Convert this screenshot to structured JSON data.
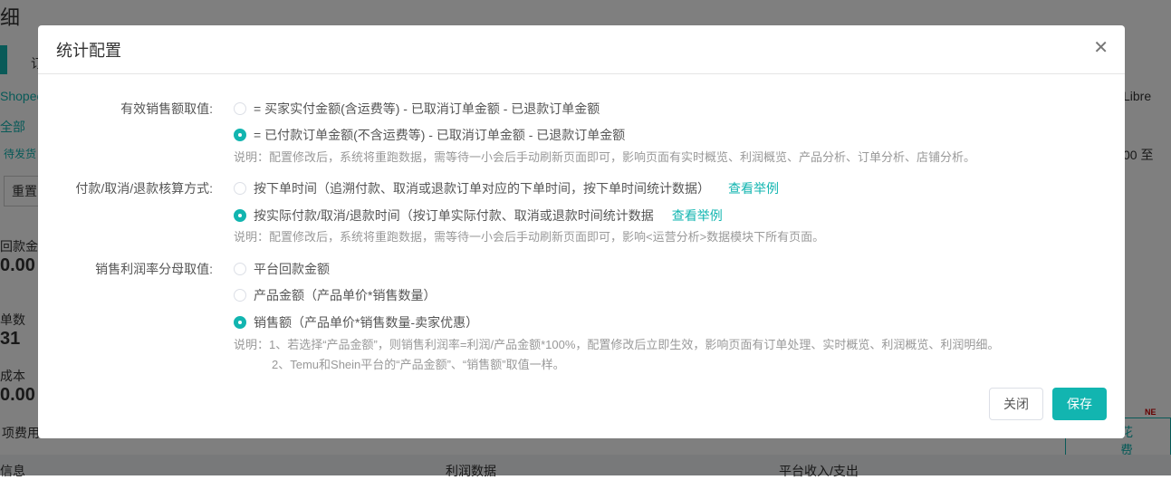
{
  "background": {
    "title": "细",
    "tab": "订",
    "shop1": "Shopee",
    "shop2": "Libre",
    "filter_all": "全部",
    "filter_pending": "待发货",
    "reset": "重置",
    "date_sep": "00 至",
    "stat1_label": "回款金额",
    "stat1_value": "0.00",
    "stat2_label": "单数",
    "stat2_value": "31",
    "stat3_label": "成本",
    "stat3_value": "0.00",
    "fee_label": "项费用",
    "fee_select": "花费",
    "new_badge": "NE",
    "section1": "信息",
    "section2": "利润数据",
    "section3": "平台收入/支出"
  },
  "dialog": {
    "title": "统计配置",
    "sections": [
      {
        "label": "有效销售额取值:",
        "options": [
          {
            "text": "= 买家实付金额(含运费等) - 已取消订单金额 - 已退款订单金额",
            "checked": false
          },
          {
            "text": "= 已付款订单金额(不含运费等) - 已取消订单金额 - 已退款订单金额",
            "checked": true
          }
        ],
        "note": "说明：配置修改后，系统将重跑数据，需等待一小会后手动刷新页面即可，影响页面有实时概览、利润概览、产品分析、订单分析、店铺分析。"
      },
      {
        "label": "付款/取消/退款核算方式:",
        "options": [
          {
            "text": "按下单时间（追溯付款、取消或退款订单对应的下单时间，按下单时间统计数据）",
            "checked": false,
            "link": "查看举例"
          },
          {
            "text": "按实际付款/取消/退款时间（按订单实际付款、取消或退款时间统计数据",
            "checked": true,
            "link": "查看举例"
          }
        ],
        "note": "说明：配置修改后，系统将重跑数据，需等待一小会后手动刷新页面即可，影响<运营分析>数据模块下所有页面。"
      },
      {
        "label": "销售利润率分母取值:",
        "options": [
          {
            "text": "平台回款金额",
            "checked": false
          },
          {
            "text": "产品金额（产品单价*销售数量）",
            "checked": false
          },
          {
            "text": "销售额（产品单价*销售数量-卖家优惠）",
            "checked": true
          }
        ],
        "note": "说明：1、若选择“产品金额”，则销售利润率=利润/产品金额*100%，配置修改后立即生效，影响页面有订单处理、实时概览、利润概览、利润明细。",
        "note2": "2、Temu和Shein平台的“产品金额”、“销售额”取值一样。"
      }
    ],
    "close_label": "关闭",
    "save_label": "保存"
  },
  "colors": {
    "accent": "#12b5b0"
  }
}
